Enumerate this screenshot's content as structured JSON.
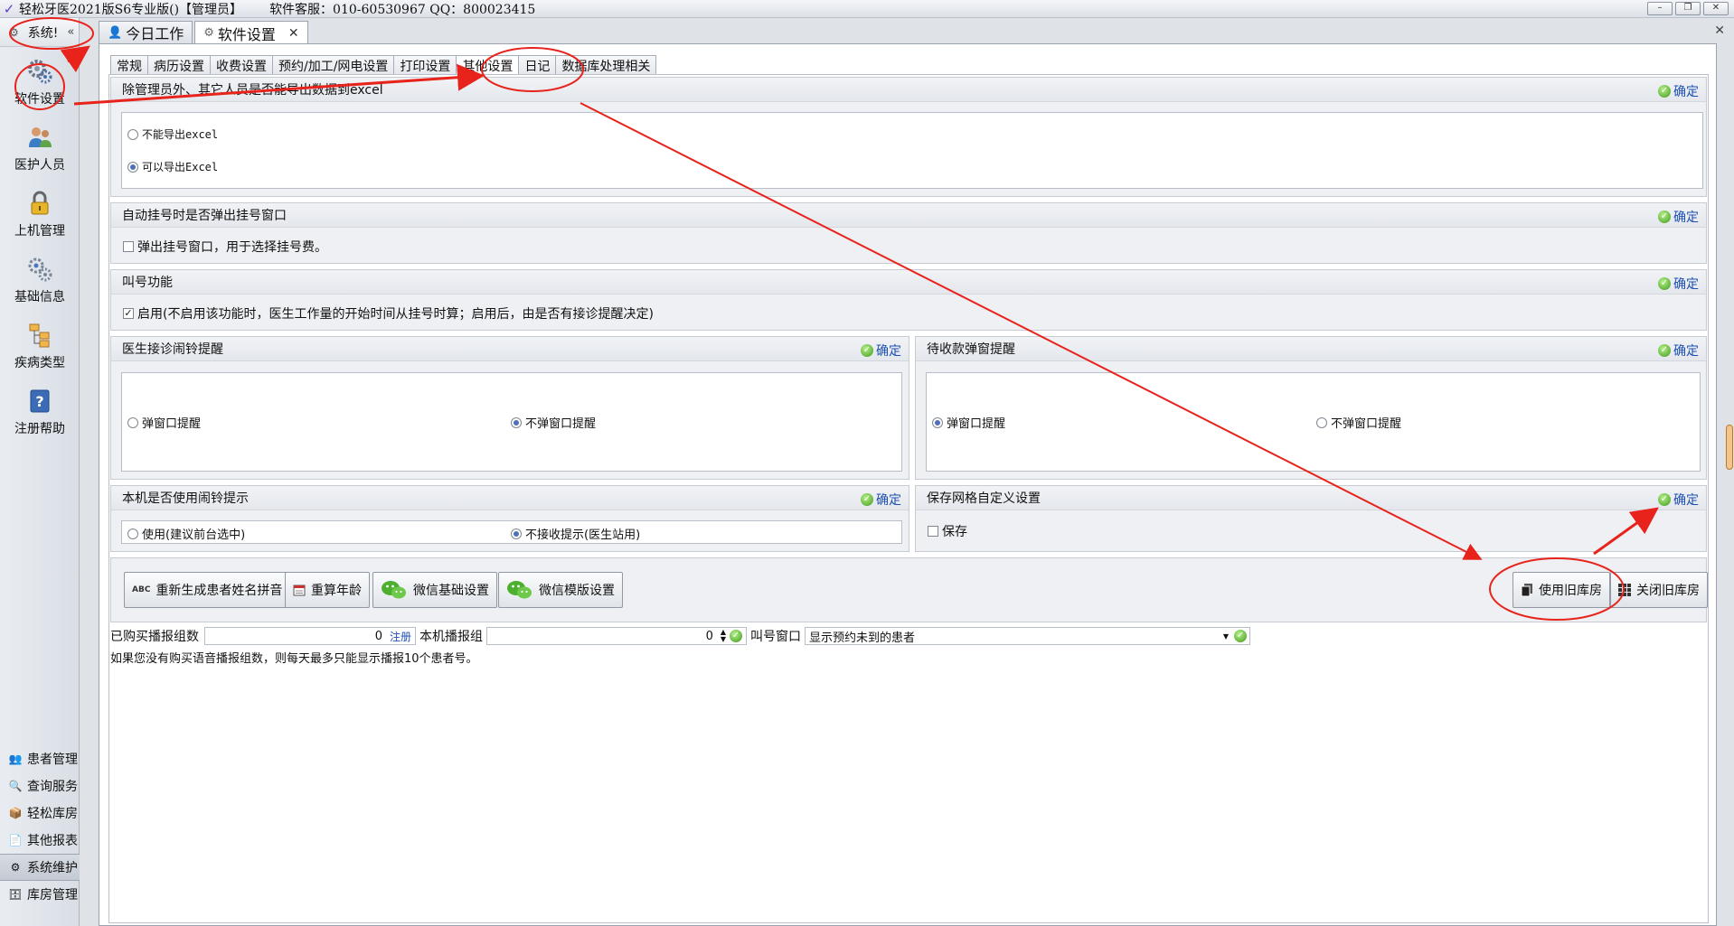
{
  "window": {
    "title": "轻松牙医2021版S6专业版()【管理员】",
    "service": "软件客服：010-60530967 QQ：800023415",
    "controls": [
      "–",
      "❐",
      "✕"
    ]
  },
  "sidebar": {
    "header": "系统!",
    "collapse": "«",
    "items": [
      {
        "label": "软件设置",
        "icon": "gear-icon"
      },
      {
        "label": "医护人员",
        "icon": "users-icon"
      },
      {
        "label": "上机管理",
        "icon": "lock-icon"
      },
      {
        "label": "基础信息",
        "icon": "settings-icon"
      },
      {
        "label": "疾病类型",
        "icon": "tree-icon"
      },
      {
        "label": "注册帮助",
        "icon": "help-icon"
      }
    ],
    "bottom": [
      {
        "label": "患者管理"
      },
      {
        "label": "查询服务"
      },
      {
        "label": "轻松库房"
      },
      {
        "label": "其他报表"
      },
      {
        "label": "系统维护"
      },
      {
        "label": "库房管理"
      }
    ]
  },
  "doc_tabs": [
    {
      "label": "今日工作"
    },
    {
      "label": "软件设置",
      "close": "✕"
    }
  ],
  "main_close": "✕",
  "sub_tabs": [
    "常规",
    "病历设置",
    "收费设置",
    "预约/加工/网电设置",
    "打印设置",
    "其他设置",
    "日记",
    "数据库处理相关"
  ],
  "confirm_label": "确定",
  "groups": {
    "export": {
      "title": "除管理员外、其它人员是否能导出数据到excel",
      "options": [
        "不能导出excel",
        "可以导出Excel"
      ],
      "selected": 1
    },
    "auto_register": {
      "title": "自动挂号时是否弹出挂号窗口",
      "check_label": "弹出挂号窗口，用于选择挂号费。"
    },
    "call": {
      "title": "叫号功能",
      "check_label": "启用(不启用该功能时，医生工作量的开始时间从挂号时算；启用后，由是否有接诊提醒决定)"
    },
    "doctor_alarm": {
      "title": "医生接诊闹铃提醒",
      "options": [
        "弹窗口提醒",
        "不弹窗口提醒"
      ],
      "selected": 1
    },
    "payment_popup": {
      "title": "待收款弹窗提醒",
      "options": [
        "弹窗口提醒",
        "不弹窗口提醒"
      ],
      "selected": 0
    },
    "local_alarm": {
      "title": "本机是否使用闹铃提示",
      "options": [
        "使用(建议前台选中)",
        "不接收提示(医生站用)"
      ],
      "selected": 1
    },
    "grid_save": {
      "title": "保存网格自定义设置",
      "check_label": "保存"
    }
  },
  "buttons": {
    "regen_pinyin": "重新生成患者姓名拼音",
    "recalc_age": "重算年龄",
    "wechat_basic": "微信基础设置",
    "wechat_template": "微信模版设置",
    "use_old_store": "使用旧库房",
    "close_old_store": "关闭旧库房"
  },
  "bottom": {
    "bought_label": "已购买播报组数",
    "bought_value": "0",
    "register_link": "注册",
    "local_label": "本机播报组",
    "local_value": "0",
    "call_window_label": "叫号窗口",
    "call_window_value": "显示预约未到的患者",
    "note": "如果您没有购买语音播报组数，则每天最多只能显示播报10个患者号。"
  },
  "colors": {
    "annotation": "#e8231c",
    "confirm_text": "#1d4fb3",
    "link": "#1d4fb3"
  }
}
